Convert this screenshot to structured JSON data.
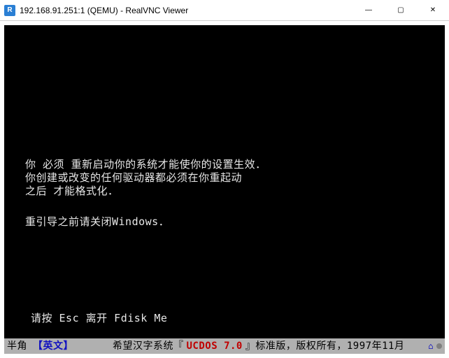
{
  "window": {
    "title": "192.168.91.251:1 (QEMU) - RealVNC Viewer",
    "icon_letter": "R",
    "min": "—",
    "max": "▢",
    "close": "✕"
  },
  "console": {
    "line1a": "你 ",
    "line1b": "必须",
    "line1c": " 重新启动你的系统才能使你的设置生效．",
    "line2": "你创建或改变的任何驱动器都必须在你重起动",
    "line3a": "之后",
    "line3b": " 才能格式化．",
    "line4": "重引导之前请关闭Windows．",
    "prompt": "请按 Esc 离开 Fdisk Me"
  },
  "status": {
    "mode": "半角",
    "lang": "【英文】",
    "sys_prefix": "希望汉字系统『",
    "product": "UCDOS 7.0",
    "suffix": "』标准版，版权所有，1997年11月",
    "right_icon": "⌂"
  }
}
